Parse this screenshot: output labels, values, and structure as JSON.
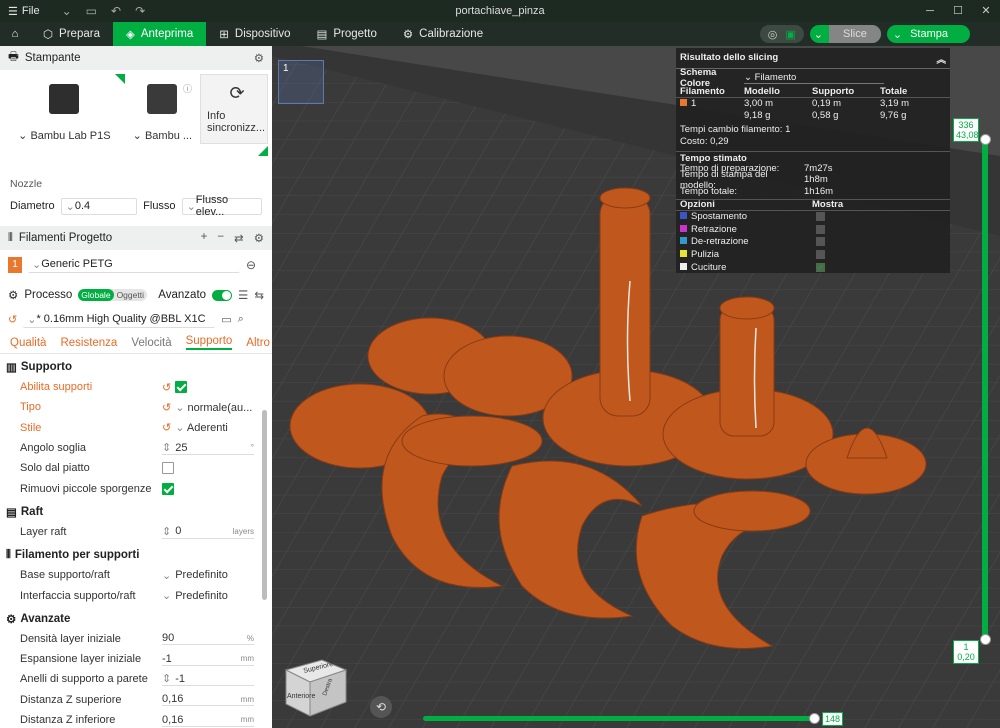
{
  "title": "portachiave_pinza",
  "file_menu": "File",
  "nav": {
    "tabs": [
      {
        "label": "Prepara"
      },
      {
        "label": "Anteprima"
      },
      {
        "label": "Dispositivo"
      },
      {
        "label": "Progetto"
      },
      {
        "label": "Calibrazione"
      }
    ],
    "slice": "Slice",
    "print": "Stampa"
  },
  "printer": {
    "header": "Stampante",
    "model": "Bambu Lab P1S",
    "plate": "Bambu ...",
    "sync": "Info sincronizz...",
    "nozzle_label": "Nozzle",
    "diameter_label": "Diametro",
    "diameter_value": "0.4",
    "flow_label": "Flusso",
    "flow_value": "Flusso elev..."
  },
  "filaments": {
    "header": "Filamenti Progetto",
    "items": [
      {
        "num": "1",
        "name": "Generic PETG",
        "color": "#e8782e"
      }
    ]
  },
  "process": {
    "header": "Processo",
    "global": "Globale",
    "objects": "Oggetti",
    "advanced": "Avanzato",
    "preset": "* 0.16mm High Quality @BBL X1C",
    "tabs": [
      "Qualità",
      "Resistenza",
      "Velocità",
      "Supporto",
      "Altro"
    ]
  },
  "settings": {
    "support": {
      "title": "Supporto",
      "enable": "Abilita supporti",
      "type": "Tipo",
      "type_value": "normale(au...",
      "style": "Stile",
      "style_value": "Aderenti",
      "threshold": "Angolo soglia",
      "threshold_value": "25",
      "threshold_unit": "°",
      "build_plate_only": "Solo dal piatto",
      "remove_small": "Rimuovi piccole sporgenze"
    },
    "raft": {
      "title": "Raft",
      "layers": "Layer raft",
      "layers_value": "0",
      "layers_unit": "layers"
    },
    "support_filament": {
      "title": "Filamento per supporti",
      "base": "Base supporto/raft",
      "base_value": "Predefinito",
      "interface": "Interfaccia supporto/raft",
      "interface_value": "Predefinito"
    },
    "advanced": {
      "title": "Avanzate",
      "initial_density": "Densità layer iniziale",
      "initial_density_value": "90",
      "initial_density_unit": "%",
      "initial_expansion": "Espansione layer iniziale",
      "initial_expansion_value": "-1",
      "unit_mm": "mm",
      "wall_loops": "Anelli di supporto a parete",
      "wall_loops_value": "-1",
      "top_z": "Distanza Z superiore",
      "top_z_value": "0,16",
      "bottom_z": "Distanza Z inferiore",
      "bottom_z_value": "0,16"
    }
  },
  "slicing": {
    "title": "Risultato dello slicing",
    "scheme_label": "Schema Colore",
    "scheme_value": "Filamento",
    "cols": [
      "Filamento",
      "Modello",
      "Supporto",
      "Totale"
    ],
    "row": {
      "num": "1",
      "model_m": "3,00 m",
      "model_g": "9,18 g",
      "support_m": "0,19 m",
      "support_g": "0,58 g",
      "total_m": "3,19 m",
      "total_g": "9,76 g"
    },
    "changes": "Tempi cambio filamento: 1",
    "cost": "Costo: 0,29",
    "time_title": "Tempo stimato",
    "prep_label": "Tempo di preparazione:",
    "prep_value": "7m27s",
    "model_time_label": "Tempo di stampa del modello:",
    "model_time_value": "1h8m",
    "total_time_label": "Tempo totale:",
    "total_time_value": "1h16m",
    "options_label": "Opzioni",
    "show_label": "Mostra",
    "options": [
      {
        "name": "Spostamento",
        "color": "#3a55c8"
      },
      {
        "name": "Retrazione",
        "color": "#cc33cc"
      },
      {
        "name": "De-retrazione",
        "color": "#3399cc"
      },
      {
        "name": "Pulizia",
        "color": "#e6e62e"
      },
      {
        "name": "Cuciture",
        "color": "#eeeeee"
      }
    ]
  },
  "layers": {
    "top_label": "336",
    "top_height": "43,08",
    "bottom_label": "1",
    "bottom_height": "0,20",
    "moves": "148"
  },
  "plate_thumb": "1",
  "cube": {
    "top": "Superiore",
    "front": "Anteriore",
    "side": "Destra"
  },
  "colors": {
    "accent": "#00ae42",
    "filament": "#c0581e",
    "highlight": "#ea6b27"
  }
}
